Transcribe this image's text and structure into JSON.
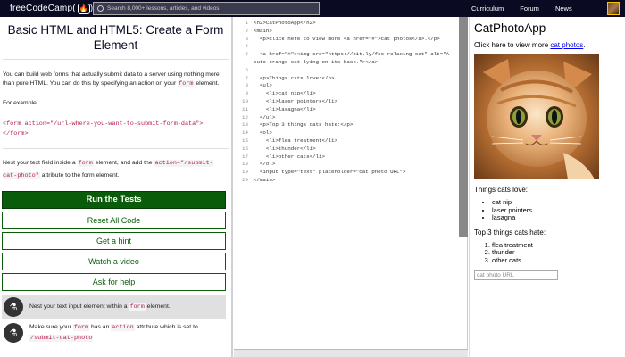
{
  "nav": {
    "logo_text": "freeCodeCamp(",
    "logo_icon": "🔥",
    "logo_close": ")",
    "search_placeholder": "Search 8,000+ lessons, articles, and videos",
    "links": [
      "Curriculum",
      "Forum",
      "News"
    ]
  },
  "challenge": {
    "title": "Basic HTML and HTML5: Create a Form Element",
    "intro_1": "You can build web forms that actually submit data to a server using nothing more than pure HTML. You can do this by specifying an action on your ",
    "intro_code": "form",
    "intro_2": " element.",
    "example_label": "For example:",
    "example_code_1": "<form action=\"/url-where-you-want-to-submit-form-data\">",
    "example_code_2": "</form>",
    "instr_1": "Nest your text field inside a ",
    "instr_code_1": "form",
    "instr_2": " element, and add the ",
    "instr_code_2": "action=\"/submit-cat-photo\"",
    "instr_3": " attribute to the form element."
  },
  "buttons": {
    "run": "Run the Tests",
    "reset": "Reset All Code",
    "hint": "Get a hint",
    "video": "Watch a video",
    "help": "Ask for help"
  },
  "tests": [
    {
      "pre": "Nest your text input element within a ",
      "code": "form",
      "post": " element."
    },
    {
      "pre": "Make sure your ",
      "code": "form",
      "mid": " has an ",
      "code2": "action",
      "post": " attribute which is set to",
      "code3": "/submit-cat-photo"
    }
  ],
  "editor": {
    "lines": [
      {
        "n": "1",
        "text": "<h2>CatPhotoApp</h2>"
      },
      {
        "n": "2",
        "text": "<main>"
      },
      {
        "n": "3",
        "text": "  <p>Click here to view more <a href=\"#\">cat photos</a>.</p>"
      },
      {
        "n": "4",
        "text": ""
      },
      {
        "n": "5",
        "text": "  <a href=\"#\"><img src=\"https://bit.ly/fcc-relaxing-cat\" alt=\"A"
      },
      {
        "n": "",
        "text": "cute orange cat lying on its back.\"></a>"
      },
      {
        "n": "6",
        "text": ""
      },
      {
        "n": "7",
        "text": "  <p>Things cats love:</p>"
      },
      {
        "n": "8",
        "text": "  <ul>"
      },
      {
        "n": "9",
        "text": "    <li>cat nip</li>"
      },
      {
        "n": "10",
        "text": "    <li>laser pointers</li>"
      },
      {
        "n": "11",
        "text": "    <li>lasagna</li>"
      },
      {
        "n": "12",
        "text": "  </ul>"
      },
      {
        "n": "13",
        "text": "  <p>Top 3 things cats hate:</p>"
      },
      {
        "n": "14",
        "text": "  <ol>"
      },
      {
        "n": "15",
        "text": "    <li>flea treatment</li>"
      },
      {
        "n": "16",
        "text": "    <li>thunder</li>"
      },
      {
        "n": "17",
        "text": "    <li>other cats</li>"
      },
      {
        "n": "18",
        "text": "  </ol>"
      },
      {
        "n": "19",
        "text": "  <input type=\"text\" placeholder=\"cat photo URL\">"
      },
      {
        "n": "20",
        "text": "</main>"
      }
    ]
  },
  "preview": {
    "title": "CatPhotoApp",
    "p_text": "Click here to view more ",
    "p_link": "cat photos",
    "p_end": ".",
    "love_label": "Things cats love:",
    "love": [
      "cat nip",
      "laser pointers",
      "lasagna"
    ],
    "hate_label": "Top 3 things cats hate:",
    "hate": [
      "flea treatment",
      "thunder",
      "other cats"
    ],
    "input_placeholder": "cat photo URL"
  },
  "colors": {
    "nav_bg": "#0a0a23",
    "run_button": "#0a5c0a",
    "code_text": "#b6224a"
  }
}
